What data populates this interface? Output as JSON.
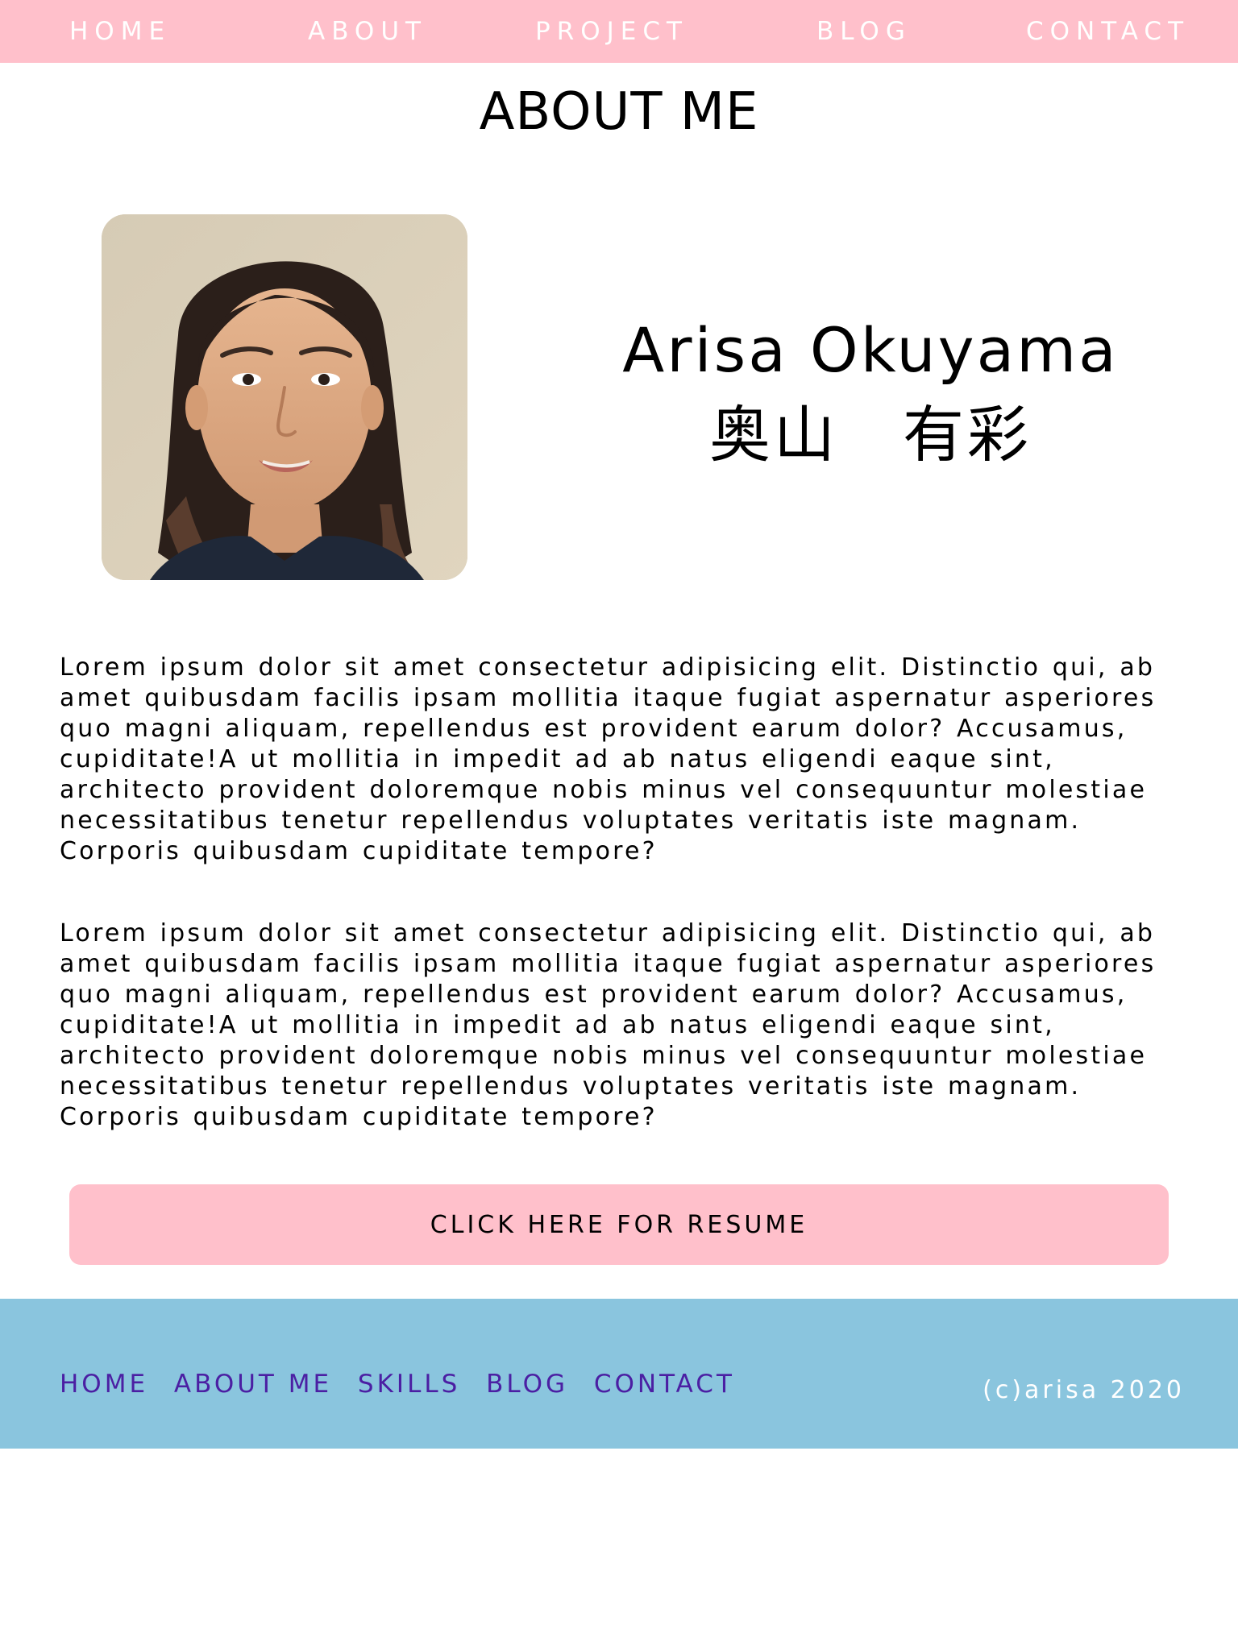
{
  "topnav": {
    "home": "HOME",
    "about": "ABOUT",
    "project": "PROJECT",
    "blog": "BLOG",
    "contact": "CONTACT"
  },
  "page": {
    "title": "ABOUT ME"
  },
  "profile": {
    "name_en": "Arisa Okuyama",
    "name_jp": "奥山　有彩"
  },
  "bio": {
    "paragraph_1": "Lorem ipsum dolor sit amet consectetur adipisicing elit. Distinctio qui, ab amet quibusdam facilis ipsam mollitia itaque fugiat aspernatur asperiores quo magni aliquam, repellendus est provident earum dolor? Accusamus, cupiditate!A ut mollitia in impedit ad ab natus eligendi eaque sint, architecto provident doloremque nobis minus vel consequuntur molestiae necessitatibus tenetur repellendus voluptates veritatis iste magnam. Corporis quibusdam cupiditate tempore?",
    "paragraph_2": "Lorem ipsum dolor sit amet consectetur adipisicing elit. Distinctio qui, ab amet quibusdam facilis ipsam mollitia itaque fugiat aspernatur asperiores quo magni aliquam, repellendus est provident earum dolor? Accusamus, cupiditate!A ut mollitia in impedit ad ab natus eligendi eaque sint, architecto provident doloremque nobis minus vel consequuntur molestiae necessitatibus tenetur repellendus voluptates veritatis iste magnam. Corporis quibusdam cupiditate tempore?"
  },
  "resume_button": {
    "label": "CLICK HERE FOR RESUME"
  },
  "footer": {
    "links": {
      "home": "HOME",
      "about_me": "ABOUT ME",
      "skills": "SKILLS",
      "blog": "BLOG",
      "contact": "CONTACT"
    },
    "copyright": "(c)arisa 2020"
  },
  "colors": {
    "nav_background": "#ffc0cb",
    "button_background": "#ffc0cb",
    "footer_background": "#8ac5de",
    "footer_link": "#4b1fa3"
  },
  "icons": {
    "profile_photo": "portrait-photo"
  }
}
